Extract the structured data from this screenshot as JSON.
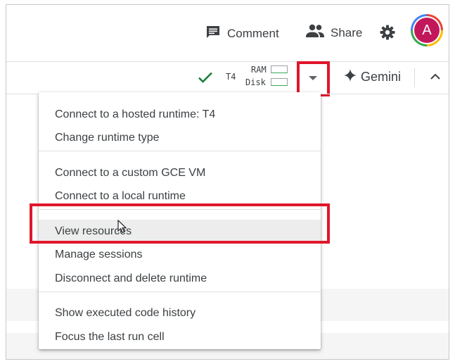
{
  "header": {
    "comment_label": "Comment",
    "share_label": "Share",
    "avatar_letter": "A"
  },
  "toolbar": {
    "runtime_label": "T4",
    "ram_label": "RAM",
    "disk_label": "Disk",
    "ram_fraction": 0.0,
    "disk_fraction": 0.0,
    "gemini_label": "Gemini"
  },
  "menu": {
    "items": [
      "Connect to a hosted runtime: T4",
      "Change runtime type",
      "Connect to a custom GCE VM",
      "Connect to a local runtime",
      "View resources",
      "Manage sessions",
      "Disconnect and delete runtime",
      "Show executed code history",
      "Focus the last run cell"
    ],
    "highlighted_item": "View resources"
  },
  "colors": {
    "accent_red": "#e0162b",
    "check_green": "#188038",
    "avatar_bg": "#c2185b"
  },
  "icons": [
    "comment-icon",
    "share-people-icon",
    "gear-icon",
    "check-icon",
    "dropdown-arrow-icon",
    "gemini-sparkle-icon",
    "chevron-up-icon",
    "mouse-cursor-icon"
  ]
}
